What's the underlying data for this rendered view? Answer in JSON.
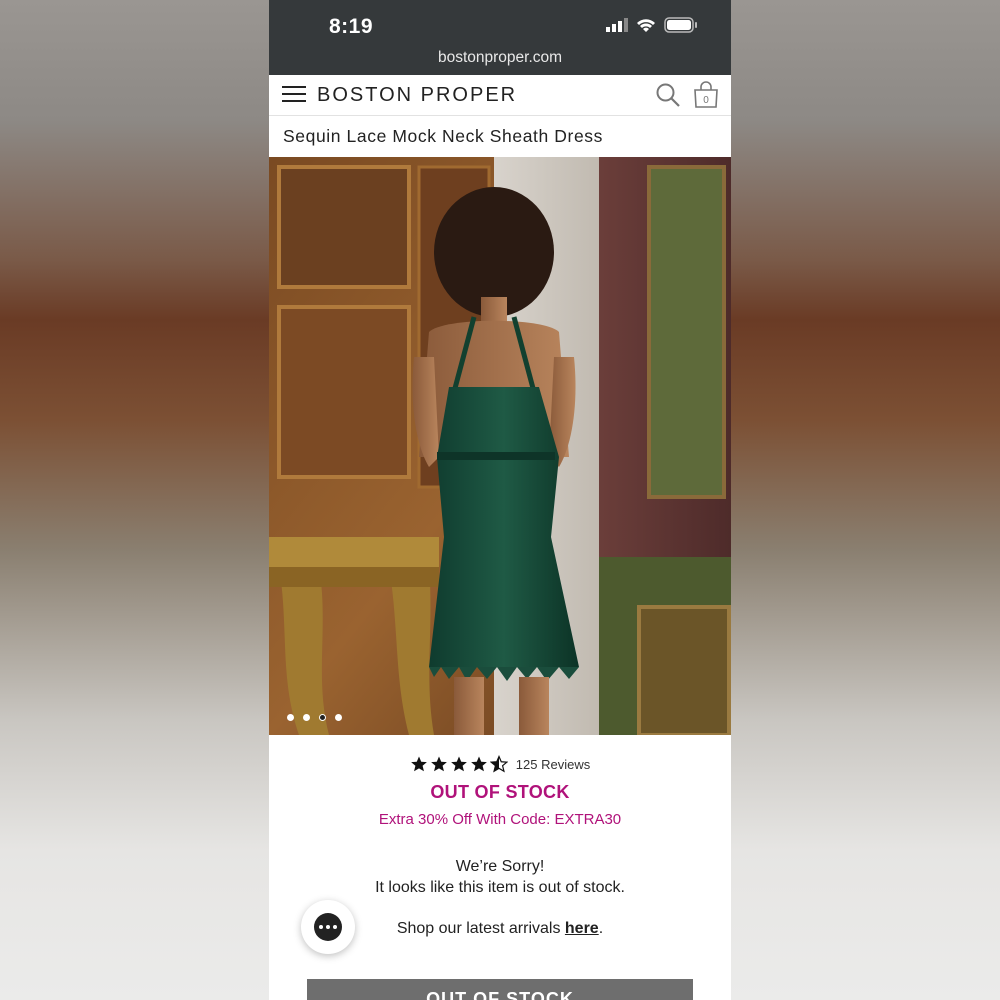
{
  "status_bar": {
    "time": "8:19",
    "url": "bostonproper.com"
  },
  "header": {
    "brand": "BOSTON PROPER",
    "cart_count": "0"
  },
  "product": {
    "title": "Sequin Lace Mock Neck Sheath Dress",
    "rating": 4.5,
    "reviews_label": "125 Reviews",
    "stock_status": "OUT OF STOCK",
    "promo": "Extra 30% Off With Code: EXTRA30",
    "sorry_line1": "We’re Sorry!",
    "sorry_line2": "It looks like this item is out of stock.",
    "shop_prefix": "Shop our latest arrivals ",
    "shop_link": "here",
    "shop_suffix": ".",
    "button_label": "OUT OF STOCK"
  },
  "carousel": {
    "slides": 4,
    "active_index": 2
  },
  "colors": {
    "accent": "#b0127a",
    "statusbar": "#35393b",
    "button": "#6e6e6e"
  },
  "icons": [
    "signal-icon",
    "wifi-icon",
    "battery-icon",
    "menu-icon",
    "search-icon",
    "bag-icon",
    "star-icon",
    "chat-icon"
  ]
}
